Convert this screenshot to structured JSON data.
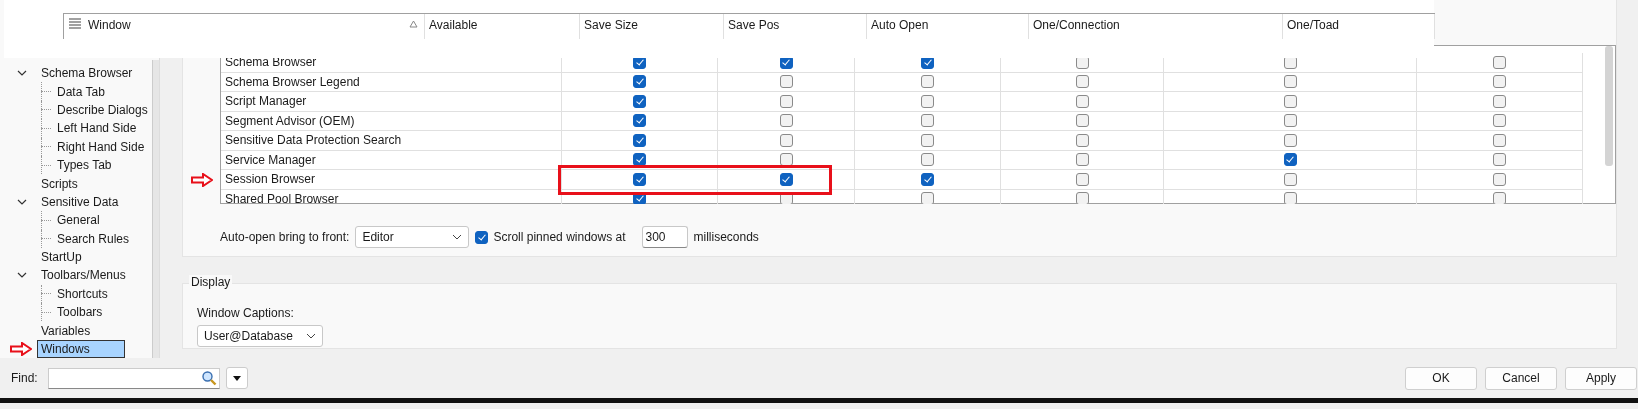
{
  "header": {
    "columns": [
      "Window",
      "Available",
      "Save Size",
      "Save Pos",
      "Auto Open",
      "One/Connection",
      "One/Toad"
    ]
  },
  "tree": [
    {
      "label": "Schema Browser",
      "expanded": true,
      "selected": false,
      "arrow": false,
      "children": [
        {
          "label": "Data Tab",
          "selected": false,
          "arrow": false
        },
        {
          "label": "Describe Dialogs",
          "selected": false,
          "arrow": false
        },
        {
          "label": "Left Hand Side",
          "selected": false,
          "arrow": false
        },
        {
          "label": "Right Hand Side",
          "selected": false,
          "arrow": false
        },
        {
          "label": "Types Tab",
          "selected": false,
          "arrow": false
        }
      ]
    },
    {
      "label": "Scripts",
      "selected": false,
      "arrow": false
    },
    {
      "label": "Sensitive Data",
      "expanded": true,
      "selected": false,
      "arrow": false,
      "children": [
        {
          "label": "General",
          "selected": false,
          "arrow": false
        },
        {
          "label": "Search Rules",
          "selected": false,
          "arrow": false
        }
      ]
    },
    {
      "label": "StartUp",
      "selected": false,
      "arrow": false
    },
    {
      "label": "Toolbars/Menus",
      "expanded": true,
      "selected": false,
      "arrow": false,
      "children": [
        {
          "label": "Shortcuts",
          "selected": false,
          "arrow": false
        },
        {
          "label": "Toolbars",
          "selected": false,
          "arrow": false
        }
      ]
    },
    {
      "label": "Variables",
      "selected": false,
      "arrow": false
    },
    {
      "label": "Windows",
      "selected": true,
      "arrow": true
    }
  ],
  "grid": {
    "rows": [
      {
        "name": "Schema Browser",
        "checks": [
          true,
          true,
          true,
          false,
          false,
          false
        ],
        "arrow": false,
        "boxed": false
      },
      {
        "name": "Schema Browser Legend",
        "checks": [
          true,
          false,
          false,
          false,
          false,
          false
        ],
        "arrow": false,
        "boxed": false
      },
      {
        "name": "Script Manager",
        "checks": [
          true,
          false,
          false,
          false,
          false,
          false
        ],
        "arrow": false,
        "boxed": false
      },
      {
        "name": "Segment Advisor (OEM)",
        "checks": [
          true,
          false,
          false,
          false,
          false,
          false
        ],
        "arrow": false,
        "boxed": false
      },
      {
        "name": "Sensitive Data Protection Search",
        "checks": [
          true,
          false,
          false,
          false,
          false,
          false
        ],
        "arrow": false,
        "boxed": false
      },
      {
        "name": "Service Manager",
        "checks": [
          true,
          false,
          false,
          false,
          true,
          false
        ],
        "arrow": false,
        "boxed": false
      },
      {
        "name": "Session Browser",
        "checks": [
          true,
          true,
          true,
          false,
          false,
          false
        ],
        "arrow": true,
        "boxed": true
      },
      {
        "name": "Shared Pool Browser",
        "checks": [
          true,
          false,
          false,
          false,
          false,
          false
        ],
        "arrow": false,
        "boxed": false
      }
    ]
  },
  "auto_open": {
    "label": "Auto-open bring to front:",
    "value": "Editor",
    "scroll_label": "Scroll pinned windows at",
    "scroll_checked": true,
    "ms_value": "300",
    "ms_label": "milliseconds"
  },
  "display": {
    "title": "Display",
    "captions_label": "Window Captions:",
    "captions_value": "User@Database"
  },
  "find": {
    "label": "Find:"
  },
  "buttons": [
    "OK",
    "Cancel",
    "Apply"
  ]
}
